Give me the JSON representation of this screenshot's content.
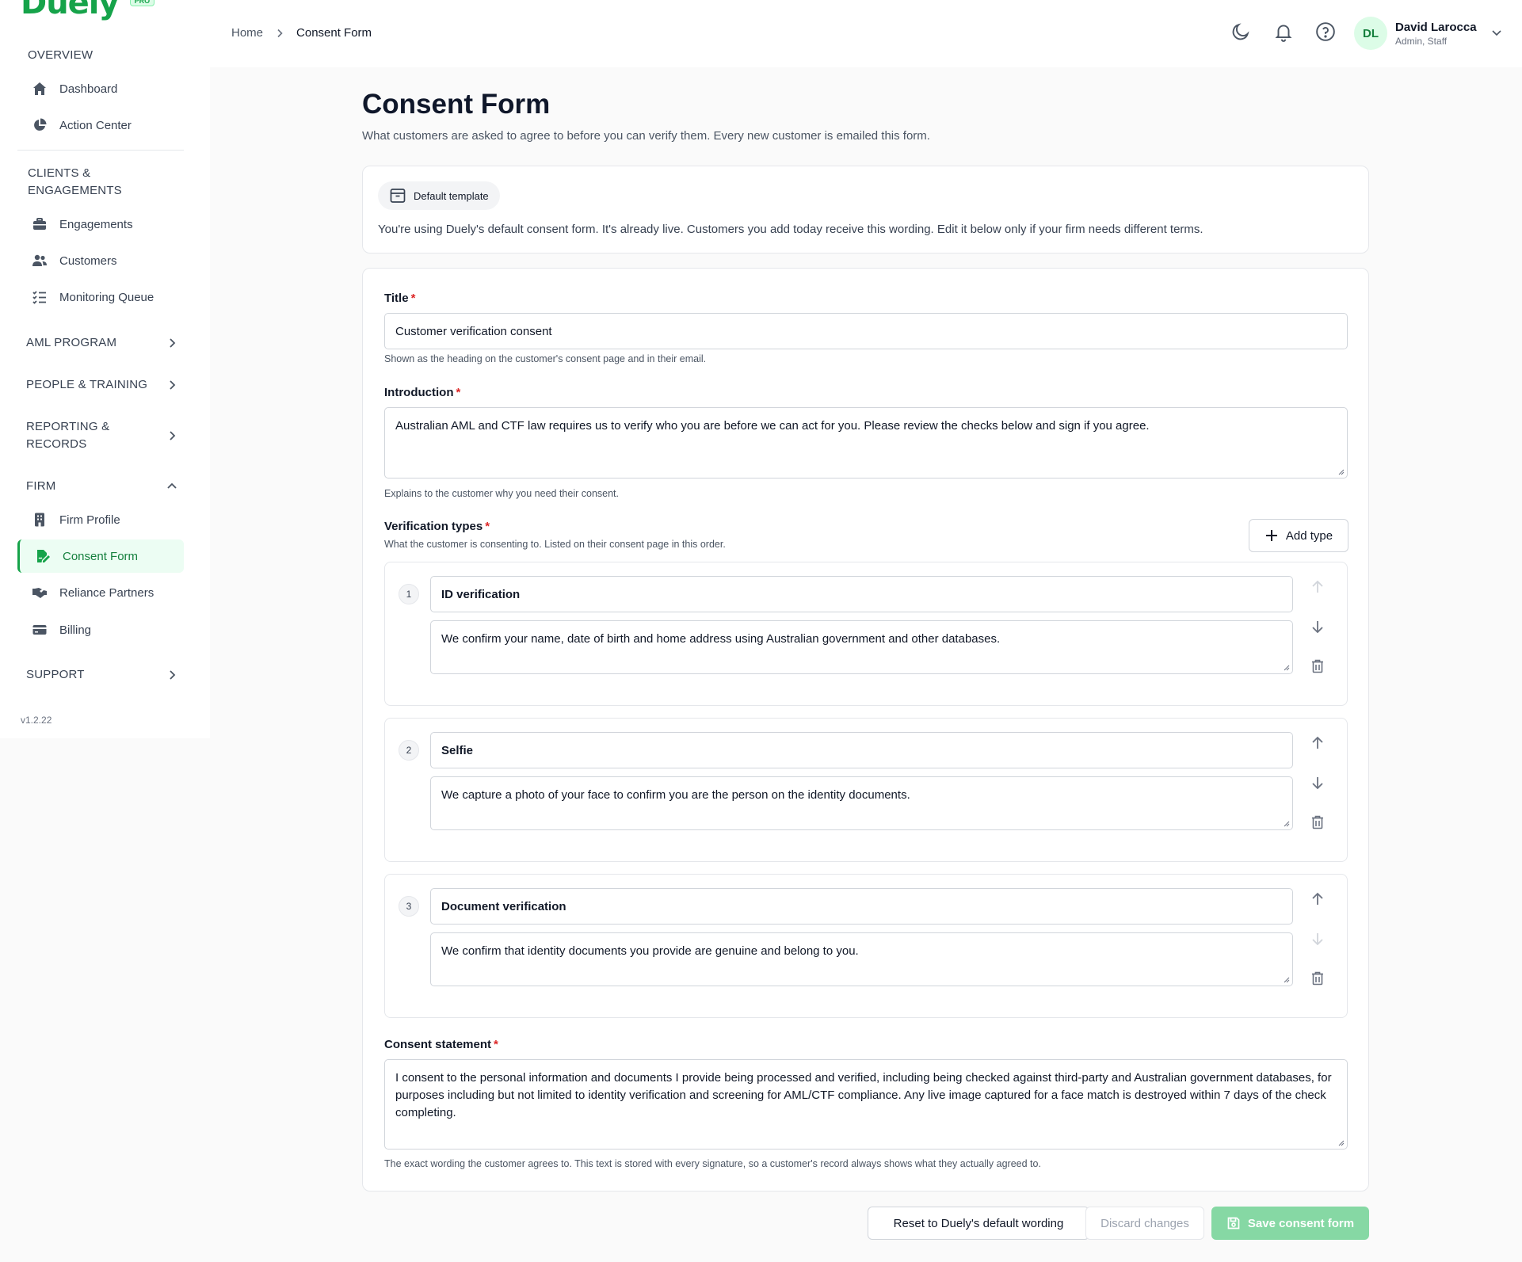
{
  "brand": {
    "logo": "Duely",
    "badge": "PRO"
  },
  "sidebar": {
    "overview_title": "OVERVIEW",
    "overview_items": [
      {
        "label": "Dashboard",
        "icon": "home-icon"
      },
      {
        "label": "Action Center",
        "icon": "pie-chart-icon"
      }
    ],
    "clients_title": "CLIENTS & ENGAGEMENTS",
    "clients_items": [
      {
        "label": "Engagements",
        "icon": "briefcase-icon"
      },
      {
        "label": "Customers",
        "icon": "users-icon"
      },
      {
        "label": "Monitoring Queue",
        "icon": "list-check-icon"
      }
    ],
    "aml_program": "AML PROGRAM",
    "people_training": "PEOPLE & TRAINING",
    "reporting_records": "REPORTING & RECORDS",
    "firm_title": "FIRM",
    "firm_items": [
      {
        "label": "Firm Profile",
        "icon": "building-icon"
      },
      {
        "label": "Consent Form",
        "icon": "signature-icon",
        "active": true
      },
      {
        "label": "Reliance Partners",
        "icon": "handshake-icon"
      },
      {
        "label": "Billing",
        "icon": "credit-card-icon"
      }
    ],
    "support": "SUPPORT",
    "version": "v1.2.22"
  },
  "header": {
    "breadcrumb": [
      "Home",
      "Consent Form"
    ],
    "icons": [
      "moon-icon",
      "bell-icon",
      "help-icon"
    ],
    "user": {
      "initials": "DL",
      "name": "David Larocca",
      "role": "Admin, Staff"
    }
  },
  "page": {
    "title": "Consent Form",
    "subtitle": "What customers are asked to agree to before you can verify them. Every new customer is emailed this form."
  },
  "banner": {
    "pill": "Default template",
    "text": "You're using Duely's default consent form. It's already live. Customers you add today receive this wording. Edit it below only if your firm needs different terms."
  },
  "form": {
    "title_label": "Title",
    "title_value": "Customer verification consent",
    "title_hint": "Shown as the heading on the customer's consent page and in their email.",
    "intro_label": "Introduction",
    "intro_value": "Australian AML and CTF law requires us to verify who you are before we can act for you. Please review the checks below and sign if you agree.",
    "intro_hint": "Explains to the customer why you need their consent.",
    "vt_label": "Verification types",
    "vt_hint": "What the customer is consenting to. Listed on their consent page in this order.",
    "add_type": "Add type",
    "types": [
      {
        "num": "1",
        "name": "ID verification",
        "desc": "We confirm your name, date of birth and home address using Australian government and other databases."
      },
      {
        "num": "2",
        "name": "Selfie",
        "desc": "We capture a photo of your face to confirm you are the person on the identity documents."
      },
      {
        "num": "3",
        "name": "Document verification",
        "desc": "We confirm that identity documents you provide are genuine and belong to you."
      }
    ],
    "consent_label": "Consent statement",
    "consent_value": "I consent to the personal information and documents I provide being processed and verified, including being checked against third-party and Australian government databases, for purposes including but not limited to identity verification and screening for AML/CTF compliance. Any live image captured for a face match is destroyed within 7 days of the check completing.",
    "consent_hint": "The exact wording the customer agrees to. This text is stored with every signature, so a customer's record always shows what they actually agreed to."
  },
  "actions": {
    "reset": "Reset to Duely's default wording",
    "discard": "Discard changes",
    "save": "Save consent form"
  },
  "colors": {
    "accent": "#16a34a",
    "active_bg": "#ecfdf3",
    "save_disabled": "#86d8a4"
  }
}
